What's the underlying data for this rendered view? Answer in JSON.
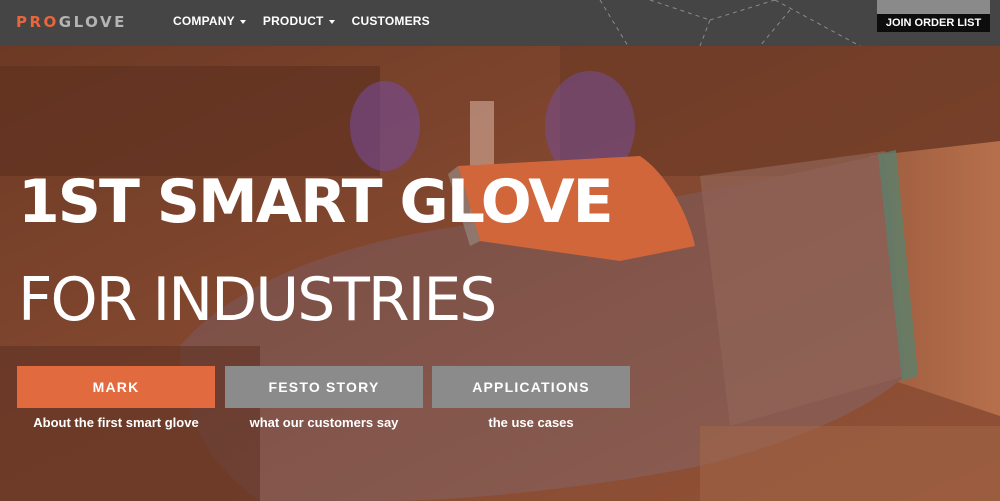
{
  "brand": {
    "logo_pro": "PRO",
    "logo_glove": "GLOVE"
  },
  "nav": {
    "items": [
      {
        "label": "COMPANY",
        "has_dropdown": true
      },
      {
        "label": "PRODUCT",
        "has_dropdown": true
      },
      {
        "label": "CUSTOMERS",
        "has_dropdown": false
      }
    ],
    "join_label": "JOIN ORDER LIST"
  },
  "hero": {
    "title_line1": "1ST SMART GLOVE",
    "title_line2": "FOR INDUSTRIES",
    "ctas": [
      {
        "label": "MARK",
        "caption": "About the first smart glove"
      },
      {
        "label": "FESTO STORY",
        "caption": "what our customers say"
      },
      {
        "label": "APPLICATIONS",
        "caption": "the use cases"
      }
    ]
  },
  "colors": {
    "accent": "#e26a3f",
    "navbar": "#454545",
    "button_grey": "#8b8b8b",
    "join_button": "#0d0d0d"
  }
}
